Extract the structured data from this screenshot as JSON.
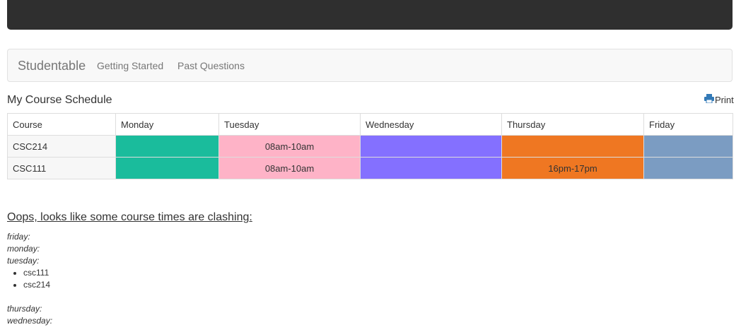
{
  "app": {
    "brand": "Studentable",
    "nav": [
      "Getting Started",
      "Past Questions"
    ]
  },
  "schedule": {
    "title": "My Course Schedule",
    "print_label": "Print",
    "columns": [
      "Course",
      "Monday",
      "Tuesday",
      "Wednesday",
      "Thursday",
      "Friday"
    ],
    "day_colors": {
      "monday": "#1abc9c",
      "tuesday": "#feb3c7",
      "wednesday": "#8470ff",
      "thursday": "#ef7722",
      "friday": "#7b9cc2"
    },
    "rows": [
      {
        "course": "CSC214",
        "monday": "",
        "tuesday": "08am-10am",
        "wednesday": "",
        "thursday": "",
        "friday": ""
      },
      {
        "course": "CSC111",
        "monday": "",
        "tuesday": "08am-10am",
        "wednesday": "",
        "thursday": "16pm-17pm",
        "friday": ""
      }
    ]
  },
  "clashes": {
    "heading": "Oops, looks like some course times are clashing:",
    "days": [
      {
        "day": "friday:",
        "courses": []
      },
      {
        "day": "monday:",
        "courses": []
      },
      {
        "day": "tuesday:",
        "courses": [
          "csc111",
          "csc214"
        ]
      },
      {
        "day": "thursday:",
        "courses": []
      },
      {
        "day": "wednesday:",
        "courses": []
      }
    ]
  }
}
